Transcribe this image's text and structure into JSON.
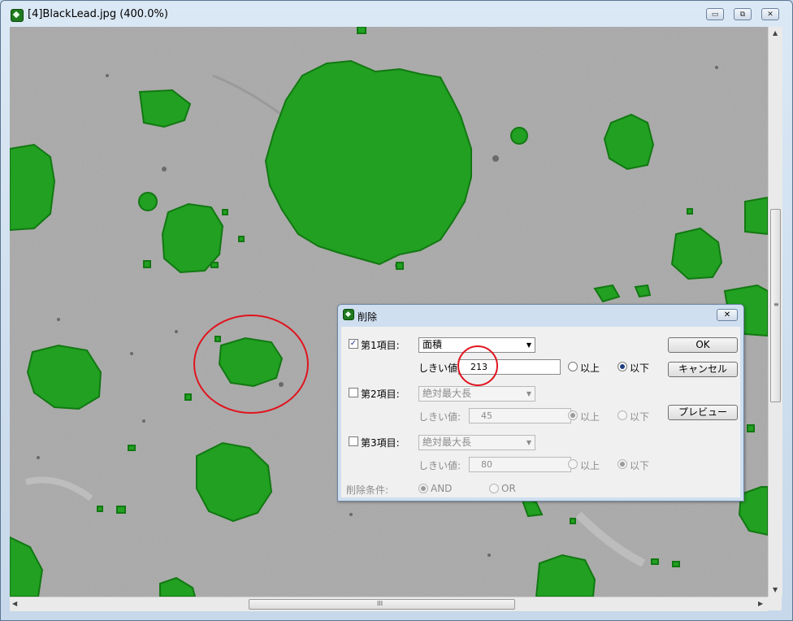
{
  "window": {
    "title": "[4]BlackLead.jpg (400.0%)",
    "controls": {
      "minimize": "▭",
      "restore": "⧉",
      "close": "✕"
    }
  },
  "colors": {
    "particle": "#21a021",
    "particle_edge": "#0f7a0f",
    "background_image": "#a9a9a9",
    "highlight_circle": "#e0141e"
  },
  "scrollbars": {
    "vertical_grip": "≡",
    "horizontal_grip": "III",
    "up": "▲",
    "down": "▼",
    "left": "◀",
    "right": "▶"
  },
  "dialog": {
    "title": "削除",
    "close": "✕",
    "row1": {
      "checked": true,
      "label": "第1項目:",
      "select_value": "面積",
      "threshold_label": "しきい値:",
      "threshold_value": "213",
      "above_label": "以上",
      "below_label": "以下",
      "selected": "below"
    },
    "row2": {
      "checked": false,
      "label": "第2項目:",
      "select_value": "絶対最大長",
      "threshold_label": "しきい値:",
      "threshold_value": "45",
      "above_label": "以上",
      "below_label": "以下",
      "selected": "above"
    },
    "row3": {
      "checked": false,
      "label": "第3項目:",
      "select_value": "絶対最大長",
      "threshold_label": "しきい値:",
      "threshold_value": "80",
      "above_label": "以上",
      "below_label": "以下",
      "selected": "below"
    },
    "condition": {
      "label": "削除条件:",
      "and_label": "AND",
      "or_label": "OR",
      "selected": "AND"
    },
    "buttons": {
      "ok": "OK",
      "cancel": "キャンセル",
      "preview": "プレビュー"
    }
  }
}
